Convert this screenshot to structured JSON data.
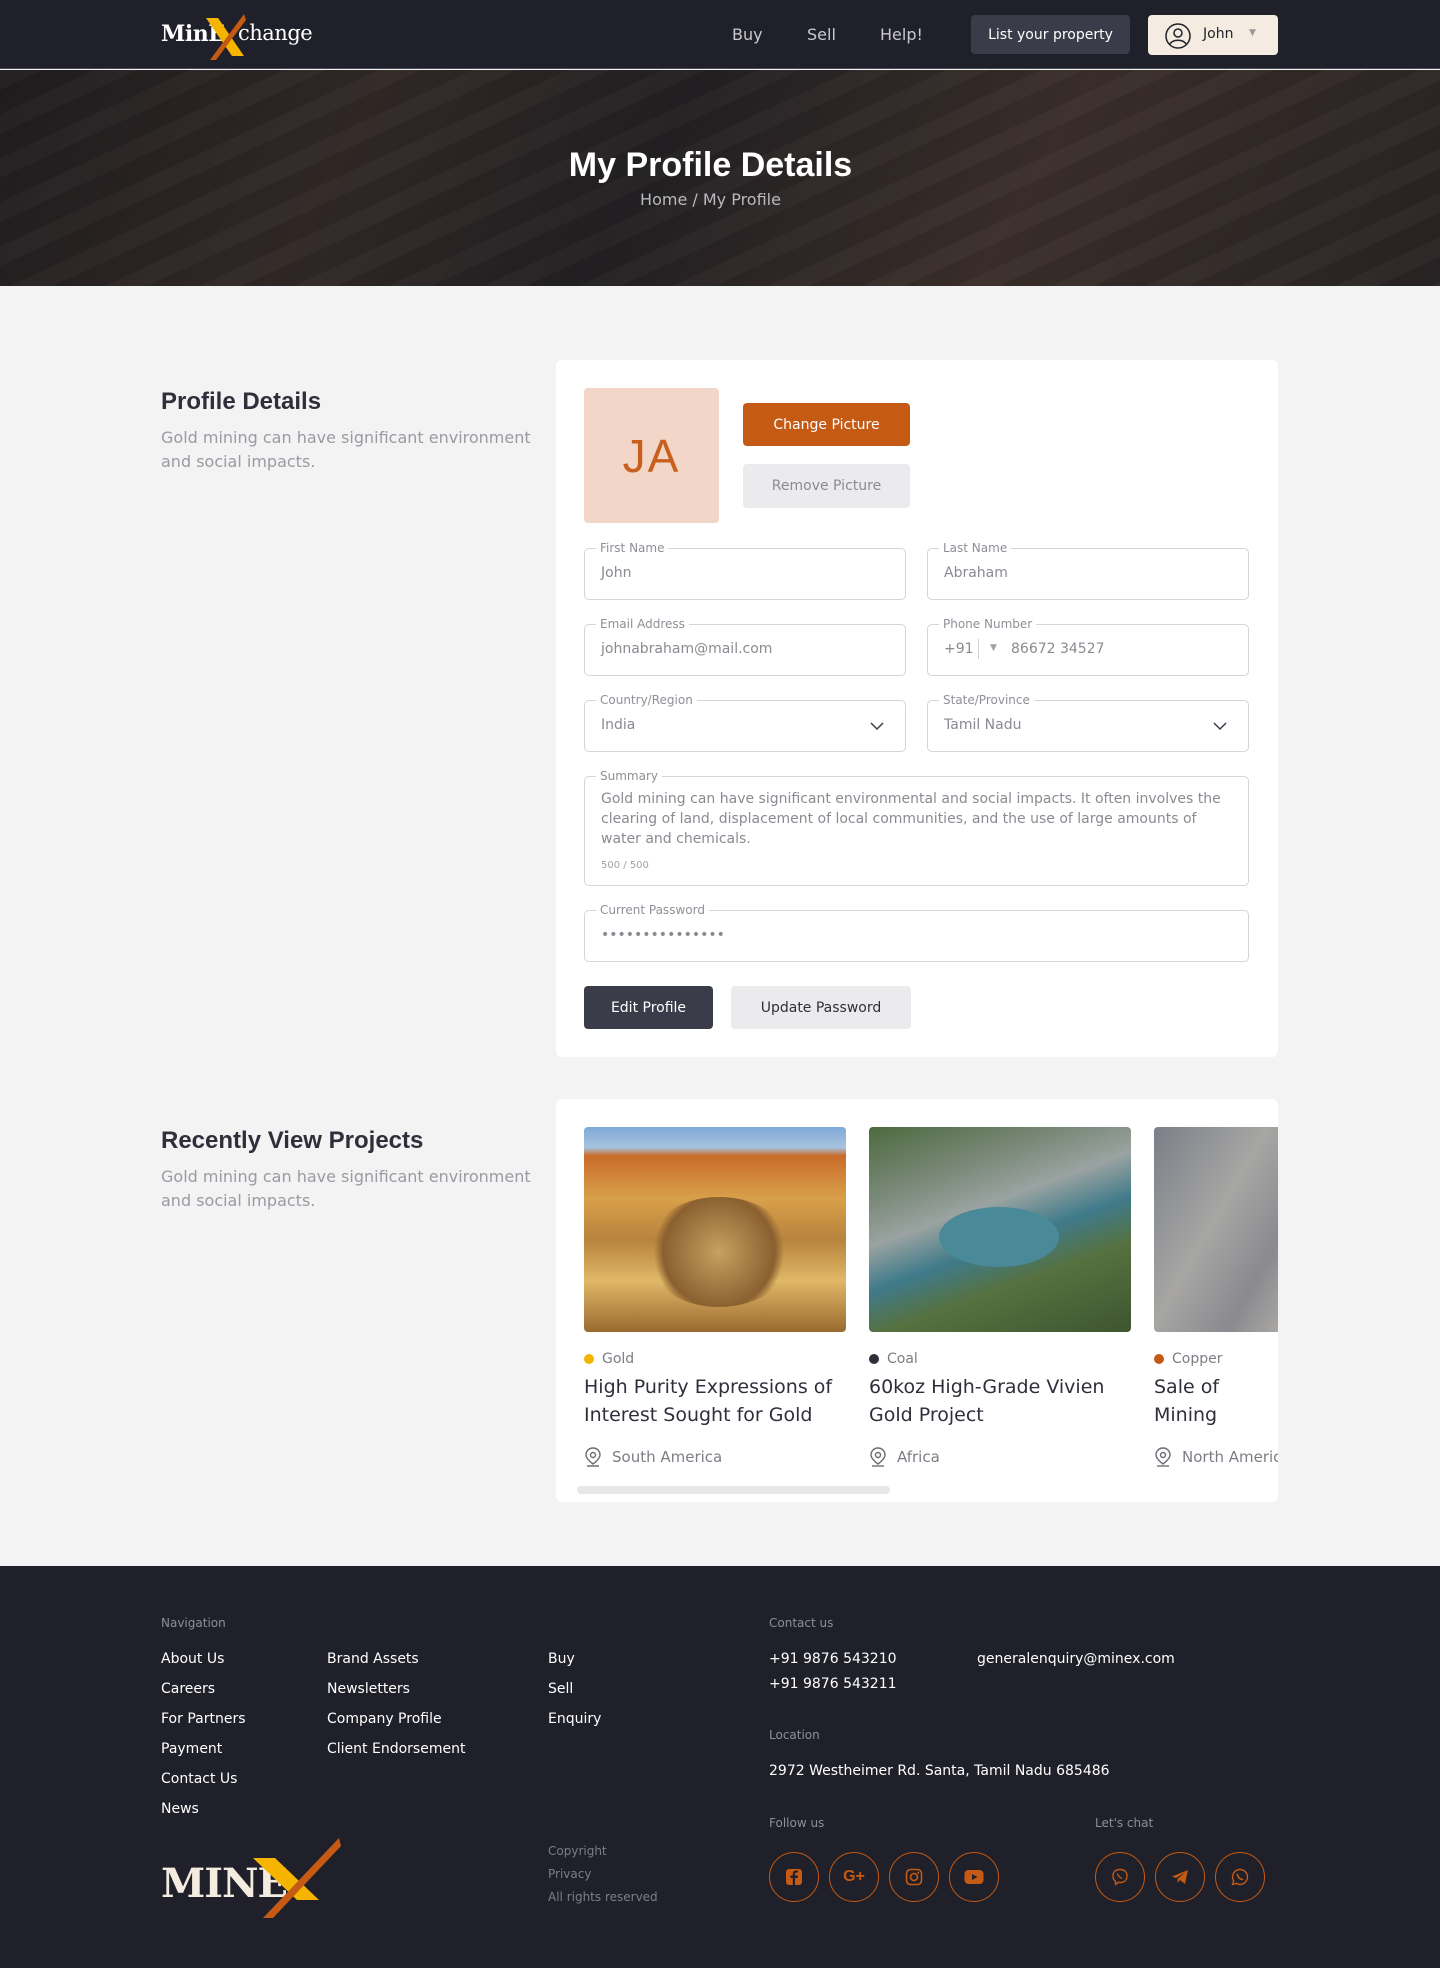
{
  "header": {
    "logo": {
      "left": "MinE",
      "right": "change"
    },
    "nav": [
      "Buy",
      "Sell",
      "Help!"
    ],
    "list_property": "List your property",
    "user_name": "John"
  },
  "hero": {
    "title": "My Profile Details",
    "breadcrumb": "Home / My Profile"
  },
  "profile_section": {
    "title": "Profile Details",
    "subtitle": "Gold mining can have significant environment and social impacts."
  },
  "profile_form": {
    "initials": "JA",
    "change_picture": "Change Picture",
    "remove_picture": "Remove Picture",
    "first_name": {
      "label": "First Name",
      "value": "John"
    },
    "last_name": {
      "label": "Last Name",
      "value": "Abraham"
    },
    "email": {
      "label": "Email Address",
      "value": "johnabraham@mail.com"
    },
    "phone": {
      "label": "Phone Number",
      "code": "+91",
      "value": "86672 34527"
    },
    "country": {
      "label": "Country/Region",
      "value": "India"
    },
    "state": {
      "label": "State/Province",
      "value": "Tamil Nadu"
    },
    "summary": {
      "label": "Summary",
      "value": "Gold mining can have significant environmental and social impacts. It often involves the clearing of land, displacement of local communities, and the use of large amounts of water and chemicals.",
      "count": "500 / 500"
    },
    "password": {
      "label": "Current Password",
      "value": "•••••••••••••••"
    },
    "edit_profile": "Edit Profile",
    "update_password": "Update Password"
  },
  "recent_section": {
    "title": "Recently View Projects",
    "subtitle": "Gold mining can have significant environment and social impacts."
  },
  "projects": [
    {
      "category": "Gold",
      "dot_color": "#f5b400",
      "title": "High Purity Expressions of Interest Sought for Gold Mi...",
      "location": "South America"
    },
    {
      "category": "Coal",
      "dot_color": "#2f2f3b",
      "title": "60koz High-Grade Vivien Gold Project",
      "location": "Africa"
    },
    {
      "category": "Copper",
      "dot_color": "#c45a14",
      "title": "Sale of Mining Exploration Te",
      "location": "North America"
    }
  ],
  "footer": {
    "navigation_label": "Navigation",
    "col1": [
      "About Us",
      "Careers",
      "For Partners",
      "Payment",
      "Contact Us",
      "News"
    ],
    "col2": [
      "Brand Assets",
      "Newsletters",
      "Company Profile",
      "Client Endorsement"
    ],
    "col3": [
      "Buy",
      "Sell",
      "Enquiry"
    ],
    "contact_label": "Contact us",
    "phones": [
      "+91 9876 543210",
      "+91 9876 543211"
    ],
    "email": "generalenquiry@minex.com",
    "location_label": "Location",
    "address": "2972 Westheimer Rd. Santa, Tamil Nadu 685486",
    "follow_label": "Follow us",
    "chat_label": "Let's chat",
    "legal": [
      "Copyright",
      "Privacy",
      "All rights reserved"
    ],
    "logo_text": "MINE",
    "accent": "#c45a14"
  }
}
